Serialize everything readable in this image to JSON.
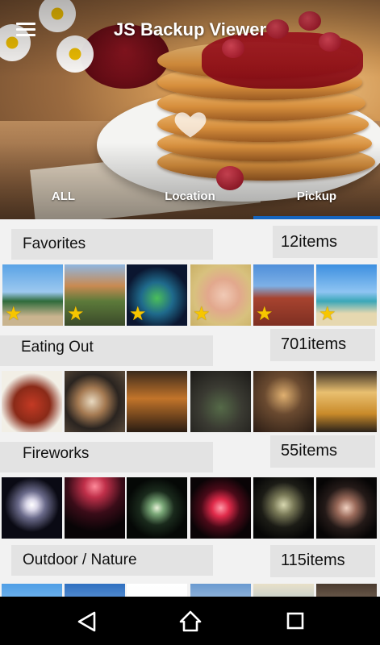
{
  "app": {
    "title": "JS Backup Viewer"
  },
  "tabs": [
    {
      "label": "ALL"
    },
    {
      "label": "Location"
    },
    {
      "label": "Pickup",
      "selected": true
    }
  ],
  "accent_color": "#1565c0",
  "sections": [
    {
      "title": "Favorites",
      "count": "12items",
      "starred": true
    },
    {
      "title": "Eating Out",
      "count": "701items",
      "starred": false
    },
    {
      "title": "Fireworks",
      "count": "55items",
      "starred": false
    },
    {
      "title": "Outdoor / Nature",
      "count": "115items",
      "starred": false
    }
  ],
  "icons": {
    "menu": "hamburger-menu-icon",
    "favorite": "heart-icon",
    "star": "star-icon",
    "nav_back": "back-triangle-icon",
    "nav_home": "home-icon",
    "nav_recents": "recents-square-icon"
  }
}
